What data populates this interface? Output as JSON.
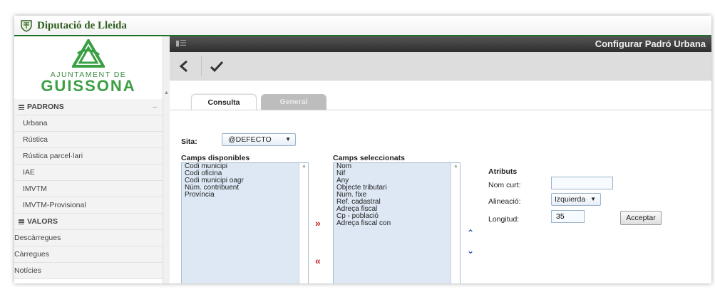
{
  "brand": {
    "name": "Diputació de Lleida"
  },
  "logo": {
    "subtitle": "AJUNTAMENT DE",
    "name": "GUISSONA"
  },
  "sidebar": {
    "padrons_label": "PADRONS",
    "items": [
      {
        "label": "Urbana"
      },
      {
        "label": "Rústica"
      },
      {
        "label": "Rústica parcel·lari"
      },
      {
        "label": "IAE"
      },
      {
        "label": "IMVTM"
      },
      {
        "label": "IMVTM-Provisional"
      }
    ],
    "valors_label": "VALORS",
    "extra_items": [
      {
        "label": "Descàrregues"
      },
      {
        "label": "Càrregues"
      },
      {
        "label": "Notícies"
      }
    ]
  },
  "header": {
    "title": "Configurar Padró Urbana"
  },
  "toolbar": {
    "back_icon": "chevron-left",
    "confirm_icon": "checkmark"
  },
  "tabs": [
    {
      "label": "Consulta",
      "active": true
    },
    {
      "label": "General",
      "active": false
    }
  ],
  "form": {
    "sita_label": "Sita:",
    "sita_value": "@DEFECTO",
    "available_label": "Camps disponibles",
    "available": [
      "Codi municipi",
      "Codi oficina",
      "Codi municipi oagr",
      "Núm. contribuent",
      "Província"
    ],
    "selected_label": "Camps seleccionats",
    "selected": [
      "Nom",
      "Nif",
      "Any",
      "Objecte tributari",
      "Num. fixe",
      "Ref. cadastral",
      "Adreça fiscal",
      "Cp - població",
      "Adreça fiscal con"
    ],
    "attributes": {
      "title": "Atributs",
      "short_name_label": "Nom curt:",
      "short_name_value": "",
      "alignment_label": "Alineació:",
      "alignment_value": "Izquierda",
      "length_label": "Longitud:",
      "length_value": "35",
      "accept_label": "Acceptar"
    }
  },
  "colors": {
    "brand_green": "#2e5d1e",
    "logo_green": "#3b9f44",
    "arrow_red": "#c62828",
    "arrow_blue": "#1a4fa0",
    "list_bg": "#dde8f4"
  }
}
